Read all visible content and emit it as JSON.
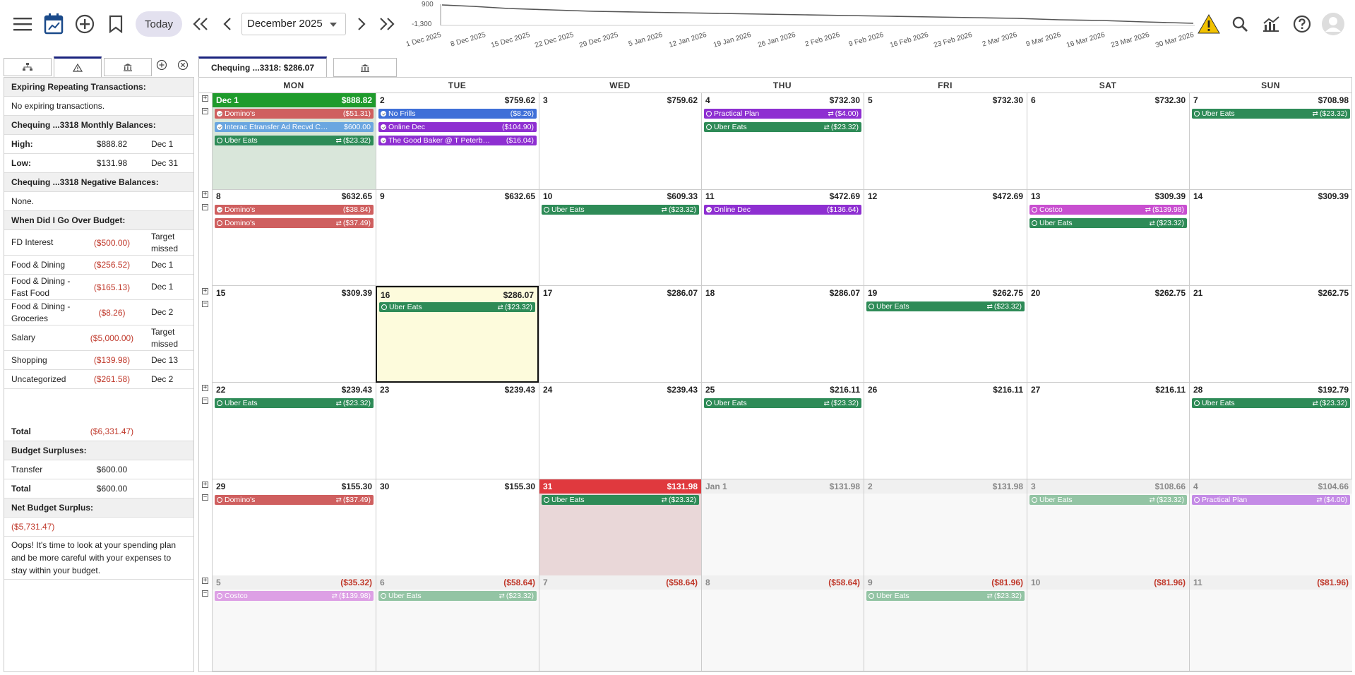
{
  "toolbar": {
    "today_label": "Today",
    "month_value": "December 2025"
  },
  "sparkline": {
    "y_labels": [
      "900",
      "-1,300"
    ],
    "x_labels": [
      "1 Dec 2025",
      "8 Dec 2025",
      "15 Dec 2025",
      "22 Dec 2025",
      "29 Dec 2025",
      "5 Jan 2026",
      "12 Jan 2026",
      "19 Jan 2026",
      "26 Jan 2026",
      "2 Feb 2026",
      "9 Feb 2026",
      "16 Feb 2026",
      "23 Feb 2026",
      "2 Mar 2026",
      "9 Mar 2026",
      "16 Mar 2026",
      "23 Mar 2026",
      "30 Mar 2026"
    ],
    "line_color": "#555555"
  },
  "left_panel": {
    "expiring_header": "Expiring Repeating Transactions:",
    "expiring_text": "No expiring transactions.",
    "monthly_header": "Chequing ...3318 Monthly Balances:",
    "high_label": "High:",
    "high_value": "$888.82",
    "high_date": "Dec 1",
    "low_label": "Low:",
    "low_value": "$131.98",
    "low_date": "Dec 31",
    "negative_header": "Chequing ...3318 Negative Balances:",
    "negative_text": "None.",
    "over_budget_header": "When Did I Go Over Budget:",
    "over_budget_rows": [
      {
        "cat": "FD Interest",
        "amt": "($500.00)",
        "when": "Target missed"
      },
      {
        "cat": "Food & Dining",
        "amt": "($256.52)",
        "when": "Dec 1"
      },
      {
        "cat": "Food & Dining - Fast Food",
        "amt": "($165.13)",
        "when": "Dec 1"
      },
      {
        "cat": "Food & Dining - Groceries",
        "amt": "($8.26)",
        "when": "Dec 2"
      },
      {
        "cat": "Salary",
        "amt": "($5,000.00)",
        "when": "Target missed"
      },
      {
        "cat": "Shopping",
        "amt": "($139.98)",
        "when": "Dec 13"
      },
      {
        "cat": "Uncategorized",
        "amt": "($261.58)",
        "when": "Dec 2"
      }
    ],
    "over_total_label": "Total",
    "over_total_amt": "($6,331.47)",
    "surplus_header": "Budget Surpluses:",
    "surplus_cat": "Transfer",
    "surplus_amt": "$600.00",
    "surplus_total_label": "Total",
    "surplus_total_amt": "$600.00",
    "net_header": "Net Budget Surplus:",
    "net_value": "($5,731.47)",
    "message": "Oops! It's time to look at your spending plan and be more careful with your expenses to stay within your budget."
  },
  "account_tab": {
    "label": "Chequing ...3318: $286.07"
  },
  "calendar": {
    "days_of_week": [
      "MON",
      "TUE",
      "WED",
      "THU",
      "FRI",
      "SAT",
      "SUN"
    ],
    "weeks": [
      {
        "days": [
          {
            "num": "Dec 1",
            "bal": "$888.82",
            "style": "green",
            "events": [
              {
                "name": "Domino's",
                "amt": "($51.31)",
                "color": "red",
                "icon": "done"
              },
              {
                "name": "Interac Etransfer Ad Recvd Cale...",
                "amt": "$600.00",
                "color": "lightblue",
                "icon": "done"
              },
              {
                "name": "Uber Eats",
                "amt": "($23.32)",
                "color": "green",
                "icon": "open",
                "repeat": true
              }
            ]
          },
          {
            "num": "2",
            "bal": "$759.62",
            "events": [
              {
                "name": "No Frills",
                "amt": "($8.26)",
                "color": "blue",
                "icon": "done"
              },
              {
                "name": "Online Dec",
                "amt": "($104.90)",
                "color": "purple",
                "icon": "done"
              },
              {
                "name": "The Good Baker @ T Peterboro...",
                "amt": "($16.04)",
                "color": "purple",
                "icon": "done"
              }
            ]
          },
          {
            "num": "3",
            "bal": "$759.62",
            "events": []
          },
          {
            "num": "4",
            "bal": "$732.30",
            "events": [
              {
                "name": "Practical Plan",
                "amt": "($4.00)",
                "color": "purple",
                "icon": "open",
                "repeat": true
              },
              {
                "name": "Uber Eats",
                "amt": "($23.32)",
                "color": "green",
                "icon": "open",
                "repeat": true
              }
            ]
          },
          {
            "num": "5",
            "bal": "$732.30",
            "events": []
          },
          {
            "num": "6",
            "bal": "$732.30",
            "events": []
          },
          {
            "num": "7",
            "bal": "$708.98",
            "events": [
              {
                "name": "Uber Eats",
                "amt": "($23.32)",
                "color": "green",
                "icon": "open",
                "repeat": true
              }
            ]
          }
        ]
      },
      {
        "days": [
          {
            "num": "8",
            "bal": "$632.65",
            "events": [
              {
                "name": "Domino's",
                "amt": "($38.84)",
                "color": "red",
                "icon": "done"
              },
              {
                "name": "Domino's",
                "amt": "($37.49)",
                "color": "red",
                "icon": "open",
                "repeat": true
              }
            ]
          },
          {
            "num": "9",
            "bal": "$632.65",
            "events": []
          },
          {
            "num": "10",
            "bal": "$609.33",
            "events": [
              {
                "name": "Uber Eats",
                "amt": "($23.32)",
                "color": "green",
                "icon": "open",
                "repeat": true
              }
            ]
          },
          {
            "num": "11",
            "bal": "$472.69",
            "events": [
              {
                "name": "Online Dec",
                "amt": "($136.64)",
                "color": "purple",
                "icon": "done"
              }
            ]
          },
          {
            "num": "12",
            "bal": "$472.69",
            "events": []
          },
          {
            "num": "13",
            "bal": "$309.39",
            "events": [
              {
                "name": "Costco",
                "amt": "($139.98)",
                "color": "magenta",
                "icon": "open",
                "repeat": true
              },
              {
                "name": "Uber Eats",
                "amt": "($23.32)",
                "color": "green",
                "icon": "open",
                "repeat": true
              }
            ]
          },
          {
            "num": "14",
            "bal": "$309.39",
            "events": []
          }
        ]
      },
      {
        "days": [
          {
            "num": "15",
            "bal": "$309.39",
            "events": []
          },
          {
            "num": "16",
            "bal": "$286.07",
            "style": "today",
            "events": [
              {
                "name": "Uber Eats",
                "amt": "($23.32)",
                "color": "green",
                "icon": "open",
                "repeat": true
              }
            ]
          },
          {
            "num": "17",
            "bal": "$286.07",
            "events": []
          },
          {
            "num": "18",
            "bal": "$286.07",
            "events": []
          },
          {
            "num": "19",
            "bal": "$262.75",
            "events": [
              {
                "name": "Uber Eats",
                "amt": "($23.32)",
                "color": "green",
                "icon": "open",
                "repeat": true
              }
            ]
          },
          {
            "num": "20",
            "bal": "$262.75",
            "events": []
          },
          {
            "num": "21",
            "bal": "$262.75",
            "events": []
          }
        ]
      },
      {
        "days": [
          {
            "num": "22",
            "bal": "$239.43",
            "events": [
              {
                "name": "Uber Eats",
                "amt": "($23.32)",
                "color": "green",
                "icon": "open",
                "repeat": true
              }
            ]
          },
          {
            "num": "23",
            "bal": "$239.43",
            "events": []
          },
          {
            "num": "24",
            "bal": "$239.43",
            "events": []
          },
          {
            "num": "25",
            "bal": "$216.11",
            "events": [
              {
                "name": "Uber Eats",
                "amt": "($23.32)",
                "color": "green",
                "icon": "open",
                "repeat": true
              }
            ]
          },
          {
            "num": "26",
            "bal": "$216.11",
            "events": []
          },
          {
            "num": "27",
            "bal": "$216.11",
            "events": []
          },
          {
            "num": "28",
            "bal": "$192.79",
            "events": [
              {
                "name": "Uber Eats",
                "amt": "($23.32)",
                "color": "green",
                "icon": "open",
                "repeat": true
              }
            ]
          }
        ]
      },
      {
        "days": [
          {
            "num": "29",
            "bal": "$155.30",
            "events": [
              {
                "name": "Domino's",
                "amt": "($37.49)",
                "color": "red",
                "icon": "open",
                "repeat": true
              }
            ]
          },
          {
            "num": "30",
            "bal": "$155.30",
            "events": []
          },
          {
            "num": "31",
            "bal": "$131.98",
            "style": "red",
            "events": [
              {
                "name": "Uber Eats",
                "amt": "($23.32)",
                "color": "green",
                "icon": "open",
                "repeat": true
              }
            ]
          },
          {
            "num": "Jan 1",
            "bal": "$131.98",
            "style": "future",
            "events": []
          },
          {
            "num": "2",
            "bal": "$131.98",
            "style": "future",
            "events": []
          },
          {
            "num": "3",
            "bal": "$108.66",
            "style": "future",
            "events": [
              {
                "name": "Uber Eats",
                "amt": "($23.32)",
                "color": "fgreen",
                "icon": "open",
                "repeat": true
              }
            ]
          },
          {
            "num": "4",
            "bal": "$104.66",
            "style": "future",
            "events": [
              {
                "name": "Practical Plan",
                "amt": "($4.00)",
                "color": "fpurple",
                "icon": "open",
                "repeat": true
              }
            ]
          }
        ]
      },
      {
        "days": [
          {
            "num": "5",
            "bal": "($35.32)",
            "style": "futureneg",
            "events": [
              {
                "name": "Costco",
                "amt": "($139.98)",
                "color": "fmagenta",
                "icon": "open",
                "repeat": true
              }
            ]
          },
          {
            "num": "6",
            "bal": "($58.64)",
            "style": "futureneg",
            "events": [
              {
                "name": "Uber Eats",
                "amt": "($23.32)",
                "color": "fgreen",
                "icon": "open",
                "repeat": true
              }
            ]
          },
          {
            "num": "7",
            "bal": "($58.64)",
            "style": "futureneg",
            "events": []
          },
          {
            "num": "8",
            "bal": "($58.64)",
            "style": "futureneg",
            "events": []
          },
          {
            "num": "9",
            "bal": "($81.96)",
            "style": "futureneg",
            "events": [
              {
                "name": "Uber Eats",
                "amt": "($23.32)",
                "color": "fgreen",
                "icon": "open",
                "repeat": true
              }
            ]
          },
          {
            "num": "10",
            "bal": "($81.96)",
            "style": "futureneg",
            "events": []
          },
          {
            "num": "11",
            "bal": "($81.96)",
            "style": "futureneg",
            "events": []
          }
        ]
      }
    ]
  },
  "colors": {
    "red": "#cf5f5f",
    "lightblue": "#6aa6e0",
    "green": "#2e8b57",
    "blue": "#3f6fd8",
    "purple": "#8e2fd1",
    "magenta": "#c84fd0",
    "fgreen": "#93c4a4",
    "fpurple": "#c48be6",
    "fmagenta": "#dda0e5",
    "negative": "#c0392b",
    "accent": "#1a237e",
    "today_bg": "#fdfbdc",
    "green_head": "#1f9b2c",
    "red_head": "#e0393e"
  }
}
